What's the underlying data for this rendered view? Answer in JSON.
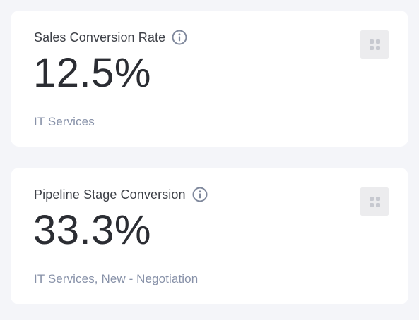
{
  "cards": [
    {
      "title": "Sales Conversion Rate",
      "value": "12.5%",
      "subtitle": "IT Services",
      "info_icon": "info-icon",
      "menu_icon": "grid-dots-icon"
    },
    {
      "title": "Pipeline Stage Conversion",
      "value": "33.3%",
      "subtitle": "IT Services, New - Negotiation",
      "info_icon": "info-icon",
      "menu_icon": "grid-dots-icon"
    }
  ],
  "colors": {
    "page_background": "#f4f5f9",
    "card_background": "#ffffff",
    "title_text": "#3d4047",
    "value_text": "#2b2d33",
    "subtitle_text": "#8791a8",
    "info_icon": "#7f889c",
    "menu_button_background": "#ececee",
    "menu_dots": "#c7c9d0"
  }
}
